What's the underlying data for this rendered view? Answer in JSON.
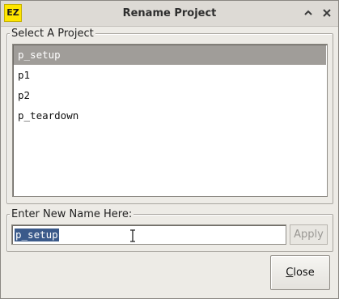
{
  "window": {
    "title": "Rename Project",
    "app_icon_text": "EZ",
    "collapse_icon": "chevron-up-icon",
    "close_icon": "close-icon"
  },
  "project_group": {
    "legend": "Select A Project",
    "items": [
      "p_setup",
      "p1",
      "p2",
      "p_teardown"
    ],
    "selected_index": 0
  },
  "name_group": {
    "legend": "Enter New Name Here:",
    "input_value": "p_setup",
    "apply_label": "Apply"
  },
  "footer": {
    "close_mnemonic": "C",
    "close_rest": "lose"
  },
  "colors": {
    "app_icon_bg": "#ffe600",
    "selection_bg": "#a09d99",
    "text_selection_bg": "#3b5a8a"
  }
}
